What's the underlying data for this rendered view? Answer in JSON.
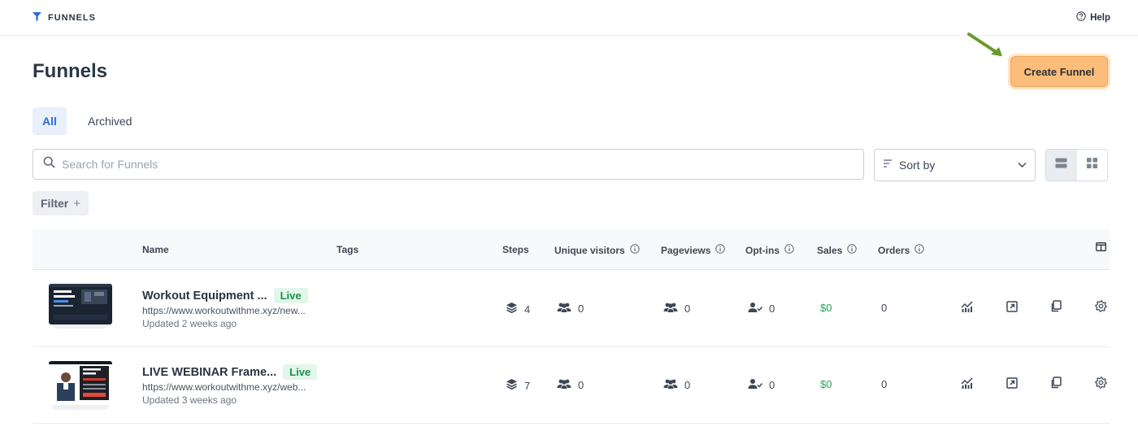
{
  "topbar": {
    "brand_label": "FUNNELS",
    "help_label": "Help"
  },
  "page": {
    "title": "Funnels",
    "create_label": "Create Funnel"
  },
  "tabs": [
    {
      "label": "All",
      "active": true
    },
    {
      "label": "Archived",
      "active": false
    }
  ],
  "search": {
    "placeholder": "Search for Funnels",
    "value": ""
  },
  "sort": {
    "label": "Sort by"
  },
  "filter": {
    "label": "Filter",
    "plus": "+"
  },
  "columns": {
    "name": "Name",
    "tags": "Tags",
    "steps": "Steps",
    "unique_visitors": "Unique visitors",
    "pageviews": "Pageviews",
    "optins": "Opt-ins",
    "sales": "Sales",
    "orders": "Orders"
  },
  "funnels": [
    {
      "name": "Workout Equipment ...",
      "status": "Live",
      "url": "https://www.workoutwithme.xyz/new...",
      "updated": "Updated 2 weeks ago",
      "steps": "4",
      "unique_visitors": "0",
      "pageviews": "0",
      "optins": "0",
      "sales": "$0",
      "orders": "0"
    },
    {
      "name": "LIVE WEBINAR Frame...",
      "status": "Live",
      "url": "https://www.workoutwithme.xyz/web...",
      "updated": "Updated 3 weeks ago",
      "steps": "7",
      "unique_visitors": "0",
      "pageviews": "0",
      "optins": "0",
      "sales": "$0",
      "orders": "0"
    }
  ],
  "colors": {
    "accent_blue": "#2f6bd8",
    "create_button": "#fbbd79",
    "live_badge_bg": "#e2f6ea",
    "live_badge_text": "#1f8f4e",
    "sales_green": "#22a559",
    "arrow_green": "#6a9a2a"
  }
}
